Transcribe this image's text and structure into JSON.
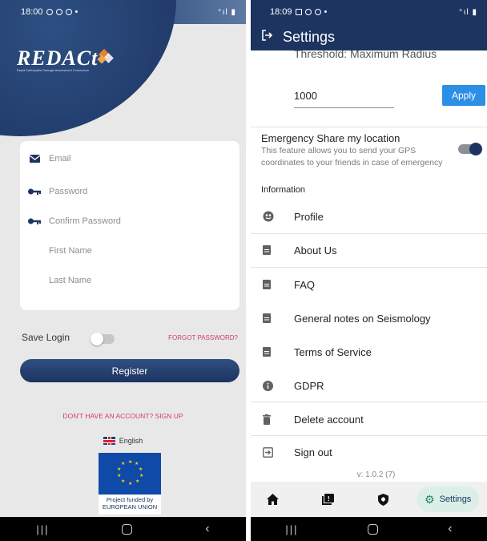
{
  "left": {
    "status": {
      "time": "18:00",
      "signal": "⁺ıl ▮"
    },
    "logo": {
      "word": "REDACt",
      "sub": "Rapid Earthquake Damage Assessment Consortium"
    },
    "form": {
      "email": "Email",
      "password": "Password",
      "confirm_password": "Confirm Password",
      "first_name": "First Name",
      "last_name": "Last Name"
    },
    "save_login": "Save Login",
    "forgot": "FORGOT PASSWORD?",
    "register": "Register",
    "signup": "DON'T HAVE AN ACCOUNT? SIGN UP",
    "language": "English",
    "eu_caption": [
      "Project funded by",
      "EUROPEAN UNION"
    ]
  },
  "right": {
    "status": {
      "time": "18:09",
      "signal": "⁺ıl ▮"
    },
    "title": "Settings",
    "threshold_label": "Threshold: Maximum Radius",
    "threshold_value": "1000",
    "apply": "Apply",
    "emergency_title": "Emergency Share my location",
    "emergency_desc": "This feature allows you to send your GPS coordinates to your friends in case of emergency",
    "emergency_enabled": true,
    "info_header": "Information",
    "menu": [
      {
        "label": "Profile",
        "icon": "profile-icon"
      },
      {
        "label": "About Us",
        "icon": "document-icon"
      },
      {
        "label": "FAQ",
        "icon": "document-icon"
      },
      {
        "label": "General notes on Seismology",
        "icon": "document-icon"
      },
      {
        "label": "Terms of Service",
        "icon": "document-icon"
      },
      {
        "label": "GDPR",
        "icon": "info-icon"
      },
      {
        "label": "Delete account",
        "icon": "trash-icon"
      },
      {
        "label": "Sign out",
        "icon": "sign-out-icon"
      }
    ],
    "version": "v: 1.0.2 (7)",
    "bottom_nav": {
      "active": "Settings"
    }
  },
  "colors": {
    "primary": "#1d3461",
    "accent_pink": "#d03a7a",
    "apply_blue": "#2b8fe6"
  }
}
